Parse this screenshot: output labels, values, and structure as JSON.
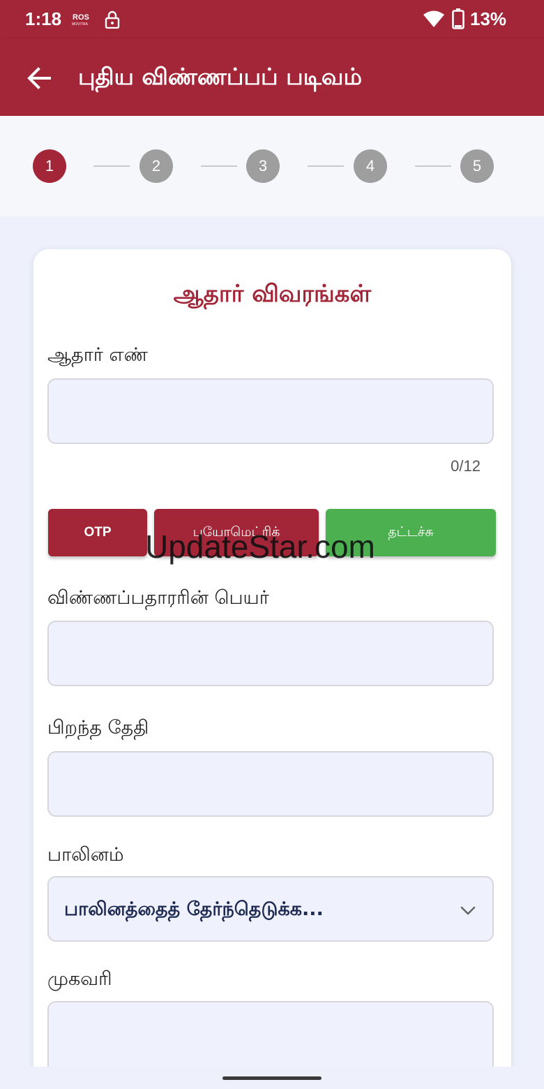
{
  "status_bar": {
    "time": "1:18",
    "battery": "13%",
    "icons": [
      "ros-app-icon",
      "lock-icon",
      "wifi-icon",
      "battery-icon"
    ]
  },
  "app_bar": {
    "title": "புதிய விண்ணப்பப் படிவம்",
    "back_icon": "arrow-left-icon"
  },
  "stepper": {
    "steps": [
      "1",
      "2",
      "3",
      "4",
      "5"
    ],
    "active_step": 1
  },
  "form": {
    "section_title": "ஆதார் விவரங்கள்",
    "aadhaar": {
      "label": "ஆதார் எண்",
      "value": "",
      "counter": "0/12"
    },
    "buttons": {
      "otp": "OTP",
      "biometric": "பயோமெட்ரிக்",
      "thumb": "தட்டச்சு"
    },
    "applicant_name": {
      "label": "விண்ணப்பதாரரின் பெயர்",
      "value": ""
    },
    "dob": {
      "label": "பிறந்த தேதி",
      "value": ""
    },
    "gender": {
      "label": "பாலினம்",
      "placeholder": "பாலினத்தைத் தேர்ந்தெடுக்க..."
    },
    "address": {
      "label": "முகவரி",
      "value": ""
    }
  },
  "watermark": "UpdateStar.com",
  "colors": {
    "primary": "#a32538",
    "success": "#4caf50",
    "inactive_step": "#9e9e9e",
    "input_bg": "#eff2fd",
    "page_bg": "#eef1fb"
  }
}
